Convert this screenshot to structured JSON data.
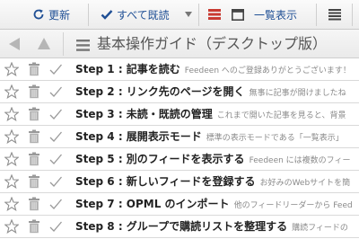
{
  "toolbar": {
    "refresh_label": "更新",
    "mark_all_read_label": "すべて既読",
    "expanded_view_label": "一覧表示",
    "refresh_icon": "refresh-icon",
    "check_icon": "check-icon",
    "dropdown_icon": "dropdown-arrow-icon",
    "expanded_view_icon": "expanded-view-icon",
    "single_view_icon": "window-view-icon",
    "list_view_icon": "list-view-icon"
  },
  "header": {
    "title": "基本操作ガイド（デスクトップ版）",
    "prev_icon": "prev-arrow-icon",
    "next_icon": "next-arrow-icon",
    "menu_icon": "menu-icon"
  },
  "entries": [
    {
      "title": "Step 1 : 記事を読む",
      "snippet": "Feedeen へのご登録ありがとうございます！"
    },
    {
      "title": "Step 2 : リンク先のページを開く",
      "snippet": "無事に記事が開けましたね"
    },
    {
      "title": "Step 3 : 未読・既読の管理",
      "snippet": "これまで開いた記事を見ると、背景"
    },
    {
      "title": "Step 4 : 展開表示モード",
      "snippet": "標準の表示モードである「一覧表示」"
    },
    {
      "title": "Step 5 : 別のフィードを表示する",
      "snippet": "Feedeen には複数のフィー"
    },
    {
      "title": "Step 6 : 新しいフィードを登録する",
      "snippet": "お好みのWebサイトを簡"
    },
    {
      "title": "Step 7 : OPML のインポート",
      "snippet": "他のフィードリーダーから Feed"
    },
    {
      "title": "Step 8 : グループで購読リストを整理する",
      "snippet": "購読フィードの"
    }
  ],
  "colors": {
    "link": "#1f4f95",
    "active_view": "#c93a32",
    "icon_gray": "#8e8e8e"
  }
}
